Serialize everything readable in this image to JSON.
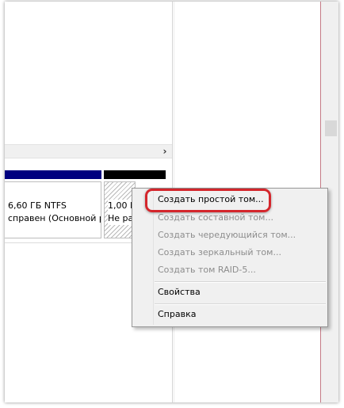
{
  "disk": {
    "partition1": {
      "line1": "6,60 ГБ NTFS",
      "line2": "справен (Основной р"
    },
    "partition2": {
      "line1": "1,00 Г",
      "line2": "Не ра"
    }
  },
  "scroll": {
    "arrow_right": "›"
  },
  "context_menu": {
    "items": [
      {
        "label": "Создать простой том...",
        "enabled": true,
        "highlighted": true
      },
      {
        "label": "Создать составной том...",
        "enabled": false
      },
      {
        "label": "Создать чередующийся том...",
        "enabled": false
      },
      {
        "label": "Создать зеркальный том...",
        "enabled": false
      },
      {
        "label": "Создать том RAID-5...",
        "enabled": false
      },
      {
        "label": "Свойства",
        "enabled": true
      },
      {
        "label": "Справка",
        "enabled": true
      }
    ]
  },
  "colors": {
    "primary_partition_bar": "#00007f",
    "unallocated_bar": "#000000",
    "highlight_outline": "#d4262c"
  }
}
